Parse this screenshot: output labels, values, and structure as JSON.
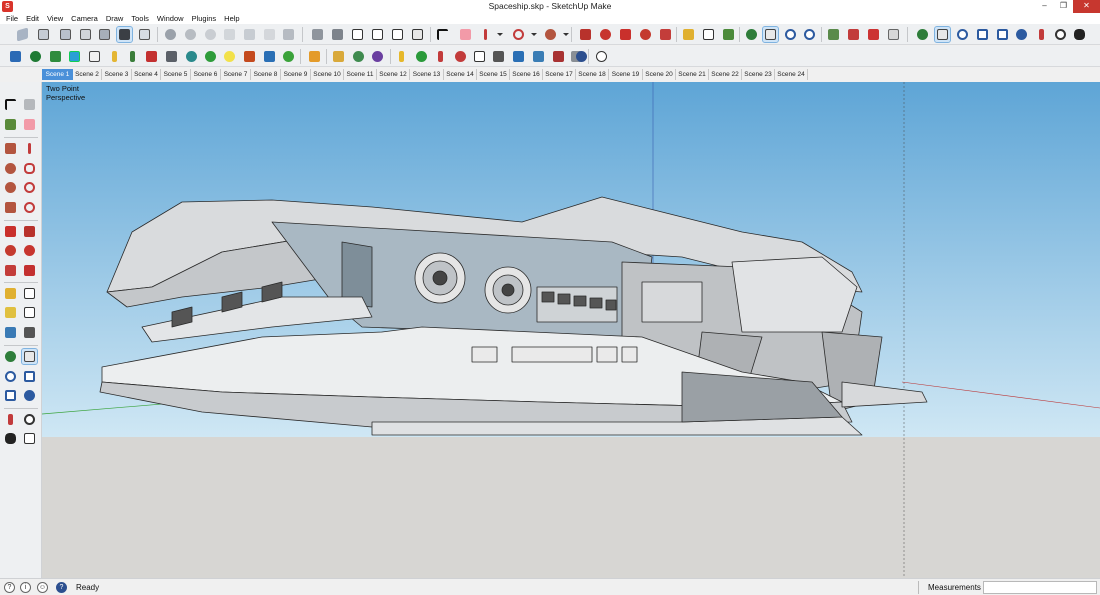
{
  "window": {
    "title": "Spaceship.skp - SketchUp Make",
    "minimize": "–",
    "maximize": "❐",
    "close": "✕"
  },
  "menu": [
    "File",
    "Edit",
    "View",
    "Camera",
    "Draw",
    "Tools",
    "Window",
    "Plugins",
    "Help"
  ],
  "scenes": [
    "Scene 1",
    "Scene 2",
    "Scene 3",
    "Scene 4",
    "Scene 5",
    "Scene 6",
    "Scene 7",
    "Scene 8",
    "Scene 9",
    "Scene 10",
    "Scene 11",
    "Scene 12",
    "Scene 13",
    "Scene 14",
    "Scene 15",
    "Scene 16",
    "Scene 17",
    "Scene 18",
    "Scene 19",
    "Scene 20",
    "Scene 21",
    "Scene 22",
    "Scene 23",
    "Scene 24"
  ],
  "active_scene": "Scene 1",
  "viewport": {
    "camera_line1": "Two Point",
    "camera_line2": "Perspective"
  },
  "status": {
    "text": "Ready",
    "measurements_label": "Measurements",
    "measurements_value": ""
  },
  "colors": {
    "sky_top": "#5ea5d6",
    "sky_bottom": "#cfe7f4",
    "ground": "#d7d6d3",
    "accent": "#4a90d9"
  }
}
